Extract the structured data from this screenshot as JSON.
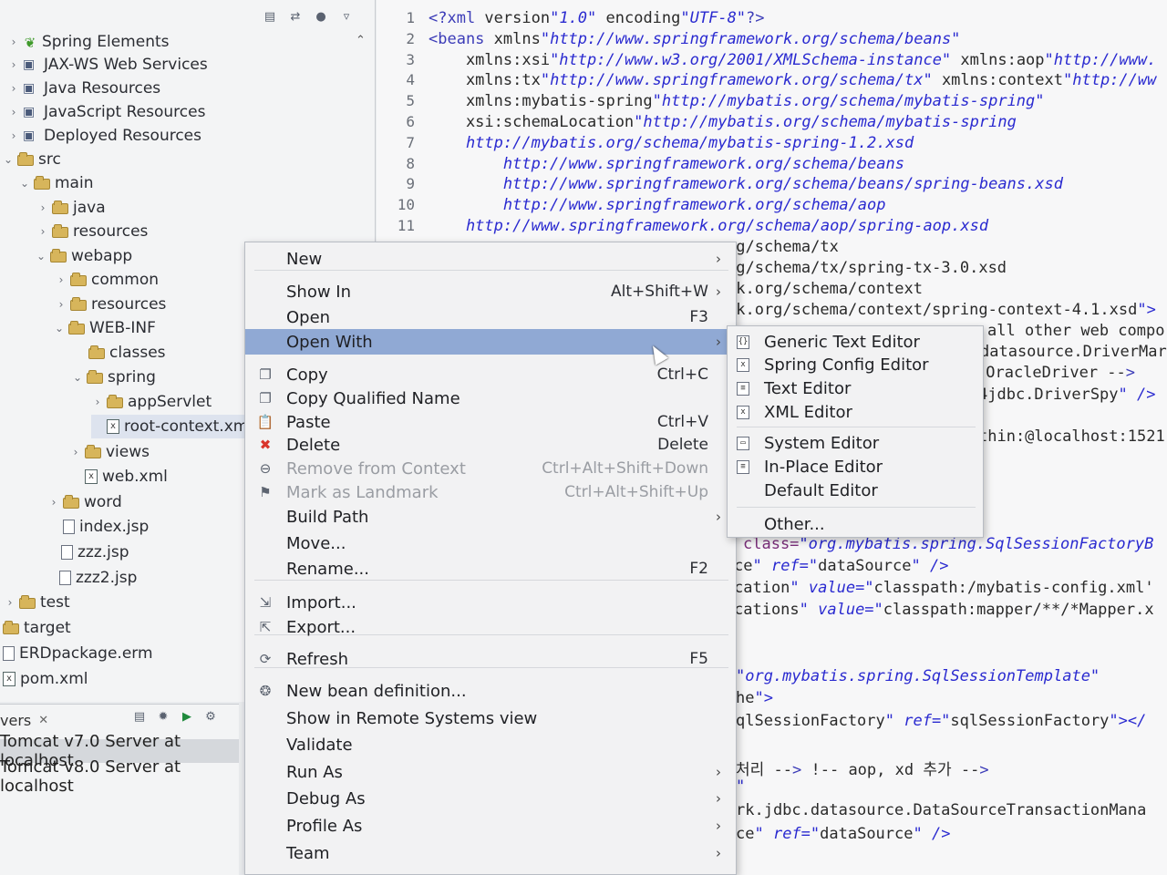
{
  "explorer": {
    "toolbar_icons": [
      "collapse-all-icon",
      "link-editor-icon",
      "filter-icon",
      "view-menu-icon"
    ],
    "items": [
      {
        "label": "Spring Elements",
        "icon": "spring-leaf-icon"
      },
      {
        "label": "JAX-WS Web Services",
        "icon": "web-services-icon"
      },
      {
        "label": "Java Resources",
        "icon": "java-resources-icon"
      },
      {
        "label": "JavaScript Resources",
        "icon": "javascript-resources-icon"
      },
      {
        "label": "Deployed Resources",
        "icon": "deployed-resources-icon"
      },
      {
        "label": "src",
        "icon": "folder-icon"
      },
      {
        "label": "main",
        "icon": "folder-icon"
      },
      {
        "label": "java",
        "icon": "folder-icon"
      },
      {
        "label": "resources",
        "icon": "folder-icon"
      },
      {
        "label": "webapp",
        "icon": "folder-icon"
      },
      {
        "label": "common",
        "icon": "folder-icon"
      },
      {
        "label": "resources",
        "icon": "folder-icon"
      },
      {
        "label": "WEB-INF",
        "icon": "folder-icon"
      },
      {
        "label": "classes",
        "icon": "folder-icon"
      },
      {
        "label": "spring",
        "icon": "folder-icon"
      },
      {
        "label": "appServlet",
        "icon": "folder-icon"
      },
      {
        "label": "root-context.xm",
        "icon": "xml-file-icon"
      },
      {
        "label": "views",
        "icon": "folder-icon"
      },
      {
        "label": "web.xml",
        "icon": "xml-file-icon"
      },
      {
        "label": "word",
        "icon": "folder-icon"
      },
      {
        "label": "index.jsp",
        "icon": "jsp-file-icon"
      },
      {
        "label": "zzz.jsp",
        "icon": "jsp-file-icon"
      },
      {
        "label": "zzz2.jsp",
        "icon": "jsp-file-icon"
      },
      {
        "label": "test",
        "icon": "folder-icon"
      },
      {
        "label": "target",
        "icon": "folder-icon"
      },
      {
        "label": "ERDpackage.erm",
        "icon": "file-icon"
      },
      {
        "label": "pom.xml",
        "icon": "maven-file-icon"
      }
    ]
  },
  "servers": {
    "tab_label": "vers",
    "rows": [
      "Tomcat v7.0 Server at localhost",
      "Tomcat v8.0 Server at localhost"
    ]
  },
  "editor": {
    "line_numbers": [
      "1",
      "2",
      "3",
      "4",
      "5",
      "6",
      "7",
      "8",
      "9",
      "10",
      "11"
    ],
    "lines": [
      "<?xml version=\"1.0\" encoding=\"UTF-8\"?>",
      "<beans xmlns=\"http://www.springframework.org/schema/beans\"",
      "    xmlns:xsi=\"http://www.w3.org/2001/XMLSchema-instance\" xmlns:aop=\"http://www.",
      "    xmlns:tx=\"http://www.springframework.org/schema/tx\" xmlns:context=\"http://ww",
      "    xmlns:mybatis-spring=\"http://mybatis.org/schema/mybatis-spring\"",
      "    xsi:schemaLocation=\"http://mybatis.org/schema/mybatis-spring",
      "    http://mybatis.org/schema/mybatis-spring-1.2.xsd",
      "        http://www.springframework.org/schema/beans",
      "        http://www.springframework.org/schema/beans/spring-beans.xsd",
      "        http://www.springframework.org/schema/aop",
      "    http://www.springframework.org/schema/aop/spring-aop.xsd"
    ],
    "visible_fragments": [
      "rg/schema/tx",
      "rg/schema/tx/spring-tx-3.0.xsd",
      "rk.org/schema/context",
      "rk.org/schema/context/spring-context-4.1.xsd\">",
      "all other web compo",
      "datasource.DriverMar",
      ".OracleDriver -->",
      "4jdbc.DriverSpy\" />",
      "thin:@localhost:1521",
      "class=\"org.mybatis.spring.SqlSessionFactoryB",
      "ce\" ref=\"dataSource\" />",
      "cation\" value=\"classpath:/mybatis-config.xml'",
      "cations\" value=\"classpath:mapper/**/*Mapper.x",
      "\"org.mybatis.spring.SqlSessionTemplate\"",
      "he\">",
      "qlSessionFactory\" ref=\"sqlSessionFactory\"></",
      "처리 --> <!-- aop, xd 추가 -->",
      "\"",
      "rk.jdbc.datasource.DataSourceTransactionMana",
      "ce\" ref=\"dataSource\" />"
    ]
  },
  "context_menu": {
    "items": [
      {
        "label": "New",
        "shortcut": "",
        "submenu": true,
        "icon": ""
      },
      {
        "label": "Show In",
        "shortcut": "Alt+Shift+W",
        "submenu": true,
        "icon": ""
      },
      {
        "label": "Open",
        "shortcut": "F3",
        "submenu": false,
        "icon": ""
      },
      {
        "label": "Open With",
        "shortcut": "",
        "submenu": true,
        "icon": "",
        "highlighted": true
      },
      {
        "label": "Copy",
        "shortcut": "Ctrl+C",
        "submenu": false,
        "icon": "copy-icon"
      },
      {
        "label": "Copy Qualified Name",
        "shortcut": "",
        "submenu": false,
        "icon": "copy-qualified-icon"
      },
      {
        "label": "Paste",
        "shortcut": "Ctrl+V",
        "submenu": false,
        "icon": "paste-icon"
      },
      {
        "label": "Delete",
        "shortcut": "Delete",
        "submenu": false,
        "icon": "delete-icon"
      },
      {
        "label": "Remove from Context",
        "shortcut": "Ctrl+Alt+Shift+Down",
        "submenu": false,
        "icon": "remove-context-icon",
        "disabled": true
      },
      {
        "label": "Mark as Landmark",
        "shortcut": "Ctrl+Alt+Shift+Up",
        "submenu": false,
        "icon": "landmark-icon",
        "disabled": true
      },
      {
        "label": "Build Path",
        "shortcut": "",
        "submenu": true,
        "icon": ""
      },
      {
        "label": "Move...",
        "shortcut": "",
        "submenu": false,
        "icon": ""
      },
      {
        "label": "Rename...",
        "shortcut": "F2",
        "submenu": false,
        "icon": ""
      },
      {
        "label": "Import...",
        "shortcut": "",
        "submenu": false,
        "icon": "import-icon"
      },
      {
        "label": "Export...",
        "shortcut": "",
        "submenu": false,
        "icon": "export-icon"
      },
      {
        "label": "Refresh",
        "shortcut": "F5",
        "submenu": false,
        "icon": "refresh-icon"
      },
      {
        "label": "New bean definition...",
        "shortcut": "",
        "submenu": false,
        "icon": "bean-icon"
      },
      {
        "label": "Show in Remote Systems view",
        "shortcut": "",
        "submenu": false,
        "icon": ""
      },
      {
        "label": "Validate",
        "shortcut": "",
        "submenu": false,
        "icon": ""
      },
      {
        "label": "Run As",
        "shortcut": "",
        "submenu": true,
        "icon": ""
      },
      {
        "label": "Debug As",
        "shortcut": "",
        "submenu": true,
        "icon": ""
      },
      {
        "label": "Profile As",
        "shortcut": "",
        "submenu": true,
        "icon": ""
      },
      {
        "label": "Team",
        "shortcut": "",
        "submenu": true,
        "icon": ""
      }
    ]
  },
  "open_with_submenu": {
    "items": [
      {
        "label": "Generic Text Editor",
        "icon": "generic-editor-icon"
      },
      {
        "label": "Spring Config Editor",
        "icon": "spring-config-icon"
      },
      {
        "label": "Text Editor",
        "icon": "text-editor-icon"
      },
      {
        "label": "XML Editor",
        "icon": "xml-editor-icon"
      },
      {
        "label": "System Editor",
        "icon": "system-editor-icon"
      },
      {
        "label": "In-Place Editor",
        "icon": "in-place-editor-icon"
      },
      {
        "label": "Default Editor",
        "icon": ""
      },
      {
        "label": "Other...",
        "icon": ""
      }
    ]
  },
  "colors": {
    "menu_highlight": "#90a9d4",
    "xml_string": "#2a2ad0",
    "xml_tag": "#3c3cb8",
    "delete_icon": "#d9342b"
  }
}
